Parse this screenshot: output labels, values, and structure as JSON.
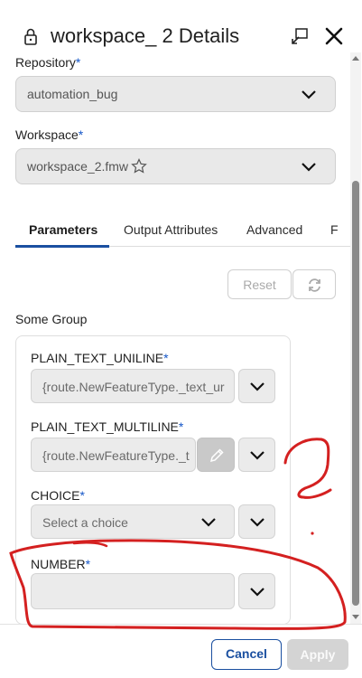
{
  "header": {
    "title": "workspace_ 2 Details",
    "icons": {
      "lock": "lock-icon",
      "popout": "popout-icon",
      "close": "close-icon"
    }
  },
  "repository": {
    "label": "Repository",
    "required_mark": "*",
    "value": "automation_bug"
  },
  "workspace": {
    "label": "Workspace",
    "required_mark": "*",
    "value": "workspace_2.fmw",
    "favorite_icon": "star-outline-icon"
  },
  "tabs": [
    {
      "label": "Parameters",
      "active": true
    },
    {
      "label": "Output Attributes",
      "active": false
    },
    {
      "label": "Advanced",
      "active": false
    },
    {
      "label": "F",
      "active": false
    }
  ],
  "toolbar": {
    "reset_label": "Reset",
    "refresh_icon": "refresh-icon"
  },
  "group": {
    "title": "Some Group",
    "fields": [
      {
        "label": "PLAIN_TEXT_UNILINE",
        "required_mark": "*",
        "value": "{route.NewFeatureType._text_ur"
      },
      {
        "label": "PLAIN_TEXT_MULTILINE",
        "required_mark": "*",
        "value": "{route.NewFeatureType._t",
        "edit_icon": "pencil-icon"
      },
      {
        "label": "CHOICE",
        "required_mark": "*",
        "placeholder": "Select a choice"
      },
      {
        "label": "NUMBER",
        "required_mark": "*",
        "value": ""
      }
    ]
  },
  "footer": {
    "cancel_label": "Cancel",
    "apply_label": "Apply"
  },
  "colors": {
    "accent": "#1a4fa0",
    "required": "#1456c8",
    "annotation": "#d42020"
  }
}
